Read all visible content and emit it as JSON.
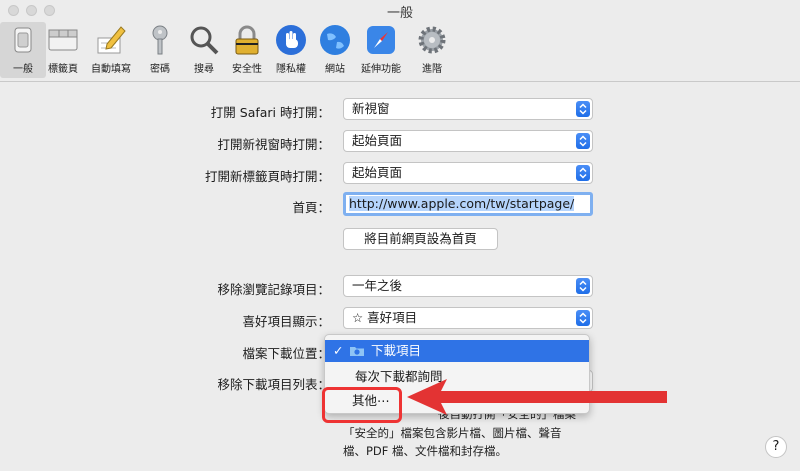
{
  "window": {
    "title": "一般"
  },
  "toolbar": {
    "tabs": [
      {
        "id": "general",
        "label": "一般"
      },
      {
        "id": "tabs",
        "label": "標籤頁"
      },
      {
        "id": "autofill",
        "label": "自動填寫"
      },
      {
        "id": "passwords",
        "label": "密碼"
      },
      {
        "id": "search",
        "label": "搜尋"
      },
      {
        "id": "security",
        "label": "安全性"
      },
      {
        "id": "privacy",
        "label": "隱私權"
      },
      {
        "id": "websites",
        "label": "網站"
      },
      {
        "id": "extensions",
        "label": "延伸功能"
      },
      {
        "id": "advanced",
        "label": "進階"
      }
    ],
    "selected": "general"
  },
  "settings": {
    "safari_opens_with": {
      "label": "打開 Safari 時打開：",
      "value": "新視窗"
    },
    "new_windows_open_with": {
      "label": "打開新視窗時打開：",
      "value": "起始頁面"
    },
    "new_tabs_open_with": {
      "label": "打開新標籤頁時打開：",
      "value": "起始頁面"
    },
    "homepage": {
      "label": "首頁：",
      "value": "http://www.apple.com/tw/startpage/"
    },
    "set_current_page_button": "將目前網頁設為首頁",
    "remove_history_items": {
      "label": "移除瀏覽記錄項目：",
      "value": "一年之後"
    },
    "favorites_shows": {
      "label": "喜好項目顯示：",
      "value": "☆ 喜好項目"
    },
    "download_location": {
      "label": "檔案下載位置："
    },
    "remove_download_list": {
      "label": "移除下載項目列表："
    }
  },
  "download_menu": {
    "items": [
      {
        "check": "✓",
        "label": "下載項目",
        "highlighted": true
      },
      {
        "check": "",
        "label": "每次下載都詢問",
        "highlighted": false
      },
      {
        "check": "",
        "label": "其他⋯",
        "highlighted": false
      }
    ]
  },
  "notes": {
    "line1_visible": "後自動打開「安全的」檔案",
    "line2": "「安全的」檔案包含影片檔、圖片檔、聲音",
    "line3": "檔、PDF 檔、文件檔和封存檔。"
  },
  "help_label": "?",
  "annotation": {
    "box_color": "#e33333",
    "arrow_color": "#e33333"
  },
  "colors": {
    "accent": "#2f73e6",
    "selection": "#b5d4fc",
    "background": "#ececec"
  }
}
